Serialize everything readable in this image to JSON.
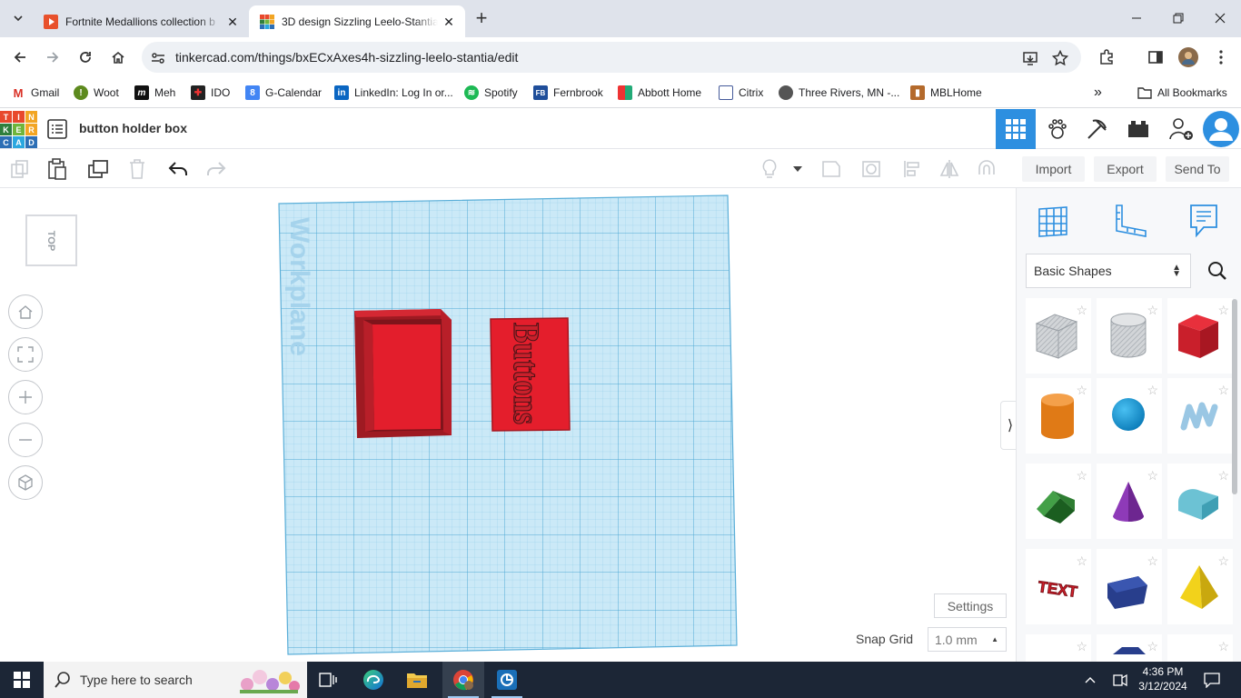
{
  "browser": {
    "tabs": [
      {
        "title": "Fortnite Medallions collection b",
        "active": false
      },
      {
        "title": "3D design Sizzling Leelo-Stantia",
        "active": true
      }
    ],
    "url": "tinkercad.com/things/bxECxAxes4h-sizzling-leelo-stantia/edit",
    "bookmarks": [
      {
        "label": "Gmail",
        "icon": "gmail-icon"
      },
      {
        "label": "Woot",
        "icon": "woot-icon"
      },
      {
        "label": "Meh",
        "icon": "meh-icon"
      },
      {
        "label": "IDO",
        "icon": "ido-icon"
      },
      {
        "label": "G-Calendar",
        "icon": "calendar-icon"
      },
      {
        "label": "LinkedIn: Log In or...",
        "icon": "linkedin-icon"
      },
      {
        "label": "Spotify",
        "icon": "spotify-icon"
      },
      {
        "label": "Fernbrook",
        "icon": "fb-icon"
      },
      {
        "label": "Abbott Home",
        "icon": "abbott-icon"
      },
      {
        "label": "Citrix",
        "icon": "citrix-icon"
      },
      {
        "label": "Three Rivers, MN -...",
        "icon": "globe-icon"
      },
      {
        "label": "MBLHome",
        "icon": "mbl-icon"
      }
    ],
    "all_bookmarks": "All Bookmarks",
    "overflow": "»"
  },
  "app": {
    "logo_letters": [
      "T",
      "I",
      "N",
      "K",
      "E",
      "R",
      "C",
      "A",
      "D"
    ],
    "logo_colors": [
      "#e8492c",
      "#e8492c",
      "#f2a523",
      "#2f7f3d",
      "#6fb53b",
      "#f2a523",
      "#2d6fb5",
      "#2aa7df",
      "#2d6fb5"
    ],
    "design_name": "button holder box",
    "accent": "#2d8fe0"
  },
  "toolbar": {
    "import": "Import",
    "export": "Export",
    "send_to": "Send To"
  },
  "canvas": {
    "viewcube_label": "TOP",
    "workplane_label": "Workplane",
    "box_text": "Buttons",
    "settings": "Settings",
    "snap_label": "Snap Grid",
    "snap_value": "1.0 mm"
  },
  "panel": {
    "shape_category": "Basic Shapes",
    "shapes": [
      "box-hole",
      "cylinder-hole",
      "box",
      "cylinder",
      "sphere",
      "scribble",
      "roof",
      "cone",
      "round-roof",
      "text",
      "polygon",
      "pyramid"
    ]
  },
  "taskbar": {
    "search_placeholder": "Type here to search",
    "time": "4:36 PM",
    "date": "3/12/2024"
  }
}
